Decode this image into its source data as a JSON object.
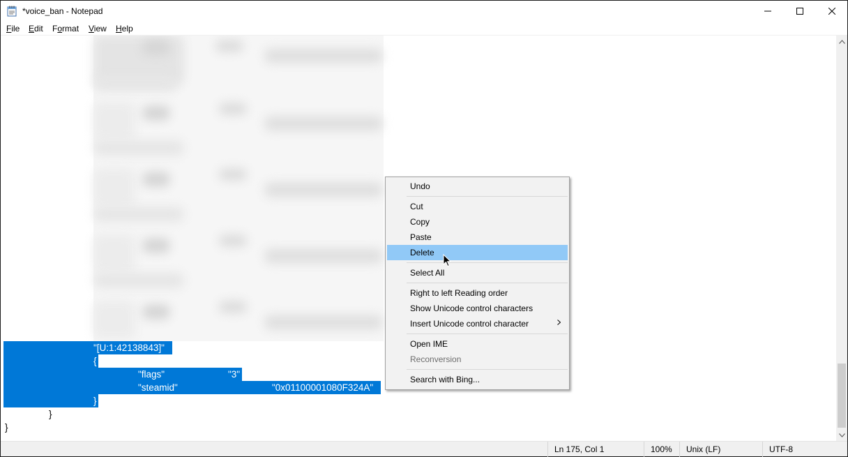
{
  "window": {
    "title": "*voice_ban - Notepad",
    "controls": {
      "minimize": "minimize",
      "maximize": "maximize",
      "close": "close"
    }
  },
  "menubar": {
    "items": [
      {
        "label": "File",
        "key": "F",
        "rest": "ile"
      },
      {
        "label": "Edit",
        "key": "E",
        "rest": "dit"
      },
      {
        "label": "Format",
        "key": "F",
        "rest": "ormat",
        "prefix": "",
        "underline_index": 1
      },
      {
        "label": "View",
        "key": "V",
        "rest": "iew"
      },
      {
        "label": "Help",
        "key": "H",
        "rest": "elp"
      }
    ]
  },
  "editor": {
    "selected_lines": [
      {
        "key": "\"[U:1:42138843]\""
      },
      {
        "key": "{"
      },
      {
        "key": "\"flags\"",
        "value": "\"3\""
      },
      {
        "key": "\"steamid\"",
        "value": "\"0x01100001080F324A\""
      },
      {
        "key": "}"
      }
    ],
    "closing_lines": [
      "}",
      "}"
    ],
    "selection_color": "#0078d7"
  },
  "context_menu": {
    "items": [
      {
        "label": "Undo",
        "state": "normal"
      },
      {
        "label": "Cut",
        "state": "normal"
      },
      {
        "label": "Copy",
        "state": "normal"
      },
      {
        "label": "Paste",
        "state": "normal"
      },
      {
        "label": "Delete",
        "state": "highlighted"
      },
      {
        "label": "Select All",
        "state": "normal"
      },
      {
        "label": "Right to left Reading order",
        "state": "normal"
      },
      {
        "label": "Show Unicode control characters",
        "state": "normal"
      },
      {
        "label": "Insert Unicode control character",
        "state": "normal",
        "submenu": true
      },
      {
        "label": "Open IME",
        "state": "normal"
      },
      {
        "label": "Reconversion",
        "state": "disabled"
      },
      {
        "label": "Search with Bing...",
        "state": "normal"
      }
    ],
    "highlight_color": "#91c9f7"
  },
  "statusbar": {
    "position": "Ln 175, Col 1",
    "zoom": "100%",
    "line_ending": "Unix (LF)",
    "encoding": "UTF-8"
  }
}
